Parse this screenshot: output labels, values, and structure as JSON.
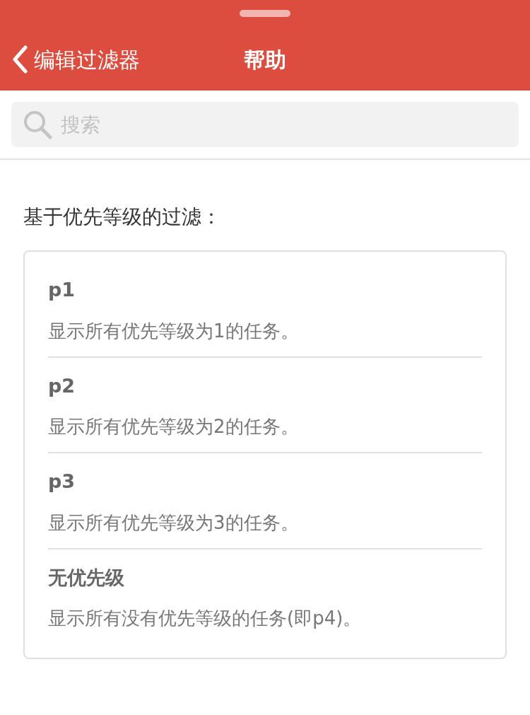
{
  "header": {
    "back_label": "编辑过滤器",
    "title": "帮助"
  },
  "search": {
    "placeholder": "搜索"
  },
  "section_title": "基于优先等级的过滤：",
  "items": [
    {
      "title": "p1",
      "description": "显示所有优先等级为1的任务。"
    },
    {
      "title": "p2",
      "description": "显示所有优先等级为2的任务。"
    },
    {
      "title": "p3",
      "description": "显示所有优先等级为3的任务。"
    },
    {
      "title": "无优先级",
      "description": "显示所有没有优先等级的任务(即p4)。"
    }
  ]
}
